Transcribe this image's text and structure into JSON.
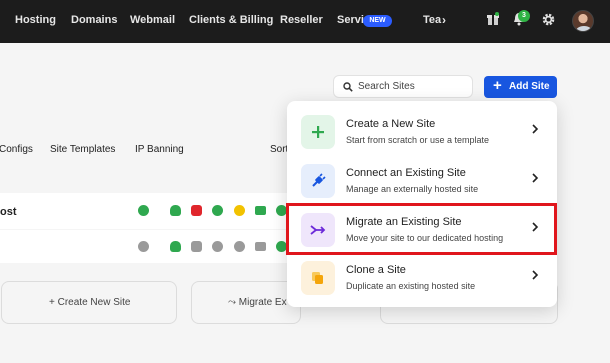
{
  "nav": {
    "items": [
      "Hosting",
      "Domains",
      "Webmail",
      "Clients & Billing",
      "Reseller",
      "Services"
    ],
    "new_badge": "NEW",
    "truncated_item": "Tea",
    "notification_count": "3"
  },
  "toolbar": {
    "search_placeholder": "Search Sites",
    "add_site_label": "Add Site",
    "accent_color": "#1856e0"
  },
  "tabs": [
    "Configs",
    "Site Templates",
    "IP Banning",
    "Sort"
  ],
  "sites": [
    {
      "name": "ost"
    },
    {
      "name": ""
    }
  ],
  "cards": {
    "create_label": "Create New Site",
    "migrate_label": "Migrate Ex"
  },
  "menu": {
    "items": [
      {
        "title": "Create a New Site",
        "subtitle": "Start from scratch or use a template",
        "icon": "plus-icon",
        "color": "#2fa84f"
      },
      {
        "title": "Connect an Existing Site",
        "subtitle": "Manage an externally hosted site",
        "icon": "plug-icon",
        "color": "#1856e0"
      },
      {
        "title": "Migrate an Existing Site",
        "subtitle": "Move your site to our dedicated hosting",
        "icon": "migrate-icon",
        "color": "#6c2bd9"
      },
      {
        "title": "Clone a Site",
        "subtitle": "Duplicate an existing hosted site",
        "icon": "copy-icon",
        "color": "#f4a50b"
      }
    ],
    "highlight_color": "#e0161c"
  }
}
